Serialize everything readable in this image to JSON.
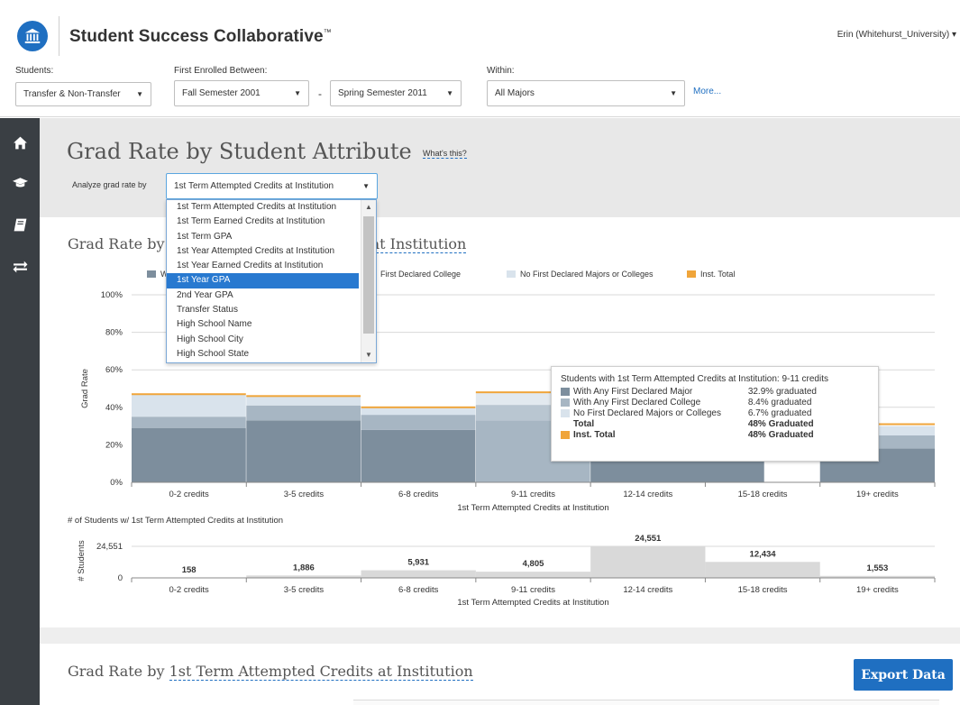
{
  "header": {
    "app_title": "Student Success Collaborative",
    "trademark": "™",
    "user": "Erin (Whitehurst_University) ▾"
  },
  "filters": {
    "students_label": "Students:",
    "students_value": "Transfer & Non-Transfer",
    "enrolled_label": "First Enrolled Between:",
    "enrolled_from": "Fall Semester 2001",
    "enrolled_dash": "-",
    "enrolled_to": "Spring Semester 2011",
    "within_label": "Within:",
    "within_value": "All Majors",
    "more_link": "More..."
  },
  "nav": {
    "icons": [
      "home-icon",
      "graduation-cap-icon",
      "book-icon",
      "transfer-arrows-icon"
    ]
  },
  "page": {
    "title": "Grad Rate by Student Attribute",
    "whats_this": "What's this?",
    "analyze_label": "Analyze grad rate by",
    "analyze_value": "1st Term Attempted Credits at Institution"
  },
  "dropdown": {
    "items": [
      "1st Term Attempted Credits at Institution",
      "1st Term Earned Credits at Institution",
      "1st Term GPA",
      "1st Year Attempted Credits at Institution",
      "1st Year Earned Credits at Institution",
      "1st Year GPA",
      "2nd Year GPA",
      "Transfer Status",
      "High School Name",
      "High School City",
      "High School State"
    ],
    "selected_index": 5
  },
  "chart_section": {
    "title_prefix": "Grad Rate by ",
    "title_suffix": "at Institution"
  },
  "legend": {
    "w_label": "W",
    "college_label": "First Declared College",
    "none_label": "No First Declared Majors or Colleges",
    "inst_label": "Inst. Total"
  },
  "colors": {
    "major": "#7d8e9d",
    "college": "#a7b6c3",
    "none": "#d9e3ec",
    "inst": "#f0a53a",
    "count_bar": "#d9d9d9",
    "accent": "#1f6fc1"
  },
  "chart_data": [
    {
      "type": "bar",
      "stacked": true,
      "ylabel": "Grad Rate",
      "xlabel": "1st Term Attempted Credits at Institution",
      "ylim": [
        0,
        100
      ],
      "yticks": [
        "0%",
        "20%",
        "40%",
        "60%",
        "80%",
        "100%"
      ],
      "categories": [
        "0-2 credits",
        "3-5 credits",
        "6-8 credits",
        "9-11 credits",
        "12-14 credits",
        "15-18 credits",
        "19+ credits"
      ],
      "series": [
        {
          "name": "With Any First Declared Major",
          "values": [
            29,
            33,
            28,
            32.9,
            null,
            null,
            18
          ]
        },
        {
          "name": "With Any First Declared College",
          "values": [
            6,
            8,
            8,
            8.4,
            null,
            null,
            7
          ]
        },
        {
          "name": "No First Declared Majors or Colleges",
          "values": [
            12,
            5,
            4,
            6.7,
            null,
            null,
            5
          ]
        }
      ],
      "inst_total": [
        47,
        46,
        40,
        48,
        null,
        null,
        31
      ]
    },
    {
      "type": "bar",
      "title": "# of Students w/ 1st Term Attempted Credits at Institution",
      "ylabel": "# Students",
      "xlabel": "1st Term Attempted Credits at Institution",
      "ylim": [
        0,
        24551
      ],
      "yticks": [
        "0",
        "24,551"
      ],
      "categories": [
        "0-2 credits",
        "3-5 credits",
        "6-8 credits",
        "9-11 credits",
        "12-14 credits",
        "15-18 credits",
        "19+ credits"
      ],
      "values": [
        158,
        1886,
        5931,
        4805,
        24551,
        12434,
        1553
      ],
      "value_labels": [
        "158",
        "1,886",
        "5,931",
        "4,805",
        "24,551",
        "12,434",
        "1,553"
      ]
    }
  ],
  "tooltip": {
    "heading": "Students with 1st Term Attempted Credits at Institution: 9-11 credits",
    "rows": [
      {
        "name": "With Any First Declared Major",
        "value": "32.9% graduated"
      },
      {
        "name": "With Any First Declared College",
        "value": "8.4% graduated"
      },
      {
        "name": "No First Declared Majors or Colleges",
        "value": "6.7% graduated"
      }
    ],
    "total_name": "Total",
    "total_value": "48% Graduated",
    "inst_name": "Inst. Total",
    "inst_value": "48% Graduated"
  },
  "second_section": {
    "title_prefix": "Grad Rate by ",
    "title_link": "1st Term Attempted Credits at Institution",
    "export_label": "Export Data"
  }
}
